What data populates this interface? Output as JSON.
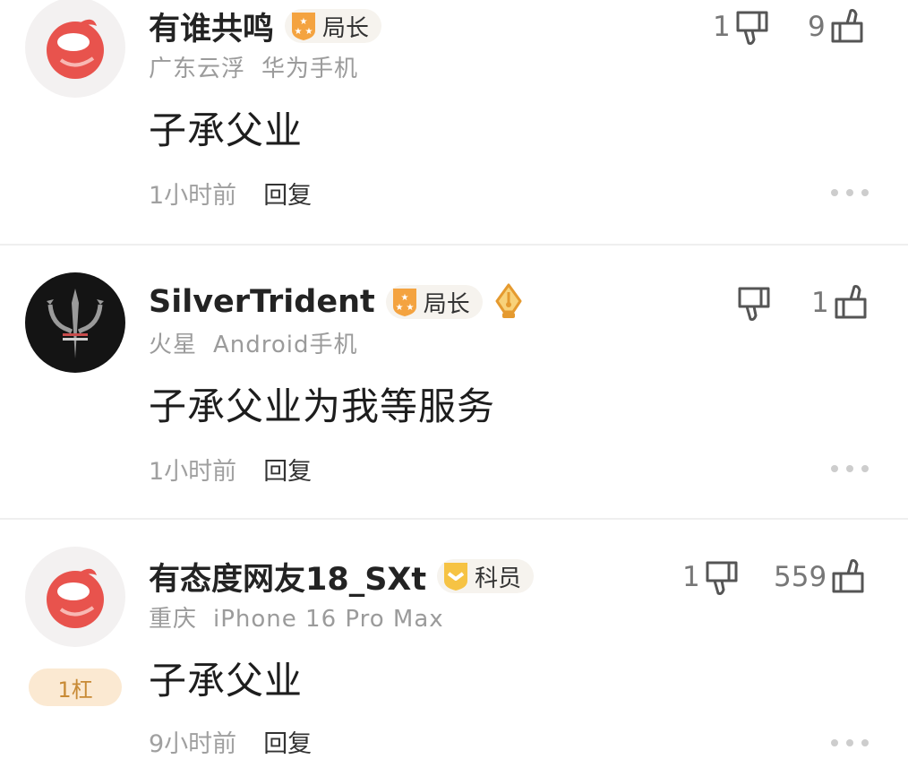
{
  "comments": [
    {
      "username": "有谁共鸣",
      "badge": "局长",
      "location": "广东云浮",
      "device": "华为手机",
      "content": "子承父业",
      "time": "1小时前",
      "reply_label": "回复",
      "dislikes": "1",
      "likes": "9",
      "avatar_icon": "default-avatar-icon",
      "badge_icon": "stars-badge-icon"
    },
    {
      "username": "SilverTrident",
      "badge": "局长",
      "location": "火星",
      "device": "Android手机",
      "content": "子承父业为我等服务",
      "time": "1小时前",
      "reply_label": "回复",
      "dislikes": "",
      "likes": "1",
      "avatar_icon": "trident-avatar-icon",
      "badge_icon": "stars-badge-icon",
      "extra_icon": "pen-nib-medal-icon"
    },
    {
      "username": "有态度网友18_SXt",
      "badge": "科员",
      "location": "重庆",
      "device": "iPhone 16 Pro Max",
      "content": "子承父业",
      "time": "9小时前",
      "reply_label": "回复",
      "dislikes": "1",
      "likes": "559",
      "avatar_icon": "default-avatar-icon",
      "badge_icon": "chevron-badge-icon",
      "floor": "1杠"
    }
  ],
  "colors": {
    "badge_orange": "#f4a340",
    "badge_yellow": "#f6c344",
    "avatar_red": "#e8534d",
    "floor_text": "#c88a35"
  }
}
